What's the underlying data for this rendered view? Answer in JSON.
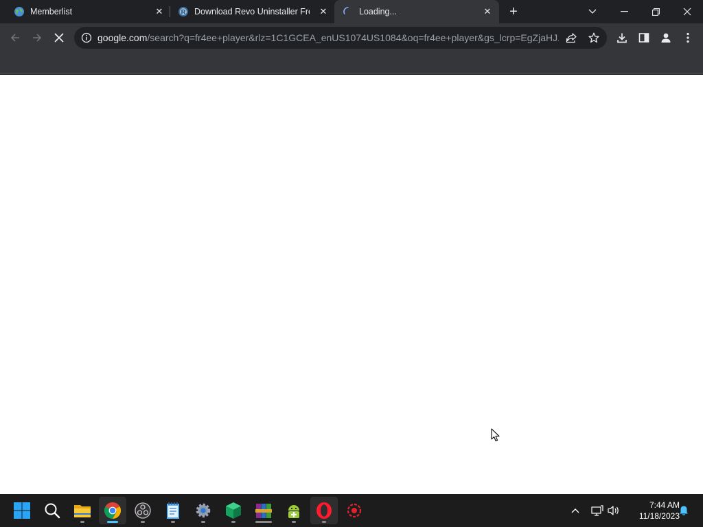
{
  "browser": {
    "tabs": [
      {
        "title": "Memberlist",
        "favicon": "globe-icon"
      },
      {
        "title": "Download Revo Uninstaller Free",
        "favicon": "revo-icon"
      },
      {
        "title": "Loading...",
        "favicon": "loading-spinner-icon",
        "active": true
      }
    ],
    "new_tab_icon": "plus-icon",
    "tab_search_icon": "chevron-down-icon",
    "window_controls": [
      "minimize-icon",
      "restore-icon",
      "close-icon"
    ],
    "address": {
      "host": "google.com",
      "path": "/search?q=fr4ee+player&rlz=1C1GCEA_enUS1074US1084&oq=fr4ee+player&gs_lcrp=EgZjaHJ..."
    },
    "toolbar_icons": [
      "back-icon",
      "forward-icon",
      "stop-icon",
      "info-icon",
      "share-icon",
      "star-icon",
      "download-icon",
      "side-panel-icon",
      "profile-icon",
      "menu-icon"
    ]
  },
  "taskbar": {
    "apps": [
      "windows-start-icon",
      "search-icon",
      "file-explorer-icon",
      "chrome-icon",
      "obs-icon",
      "notepad-icon",
      "settings-icon",
      "cube-app-icon",
      "winrar-icon",
      "android-app-icon",
      "opera-icon",
      "gaming-app-icon"
    ],
    "clock": {
      "time": "7:44 AM",
      "date": "11/18/2023"
    },
    "tray_icons": [
      "chevron-up-icon",
      "network-icon",
      "volume-icon",
      "notification-bell-icon"
    ]
  }
}
